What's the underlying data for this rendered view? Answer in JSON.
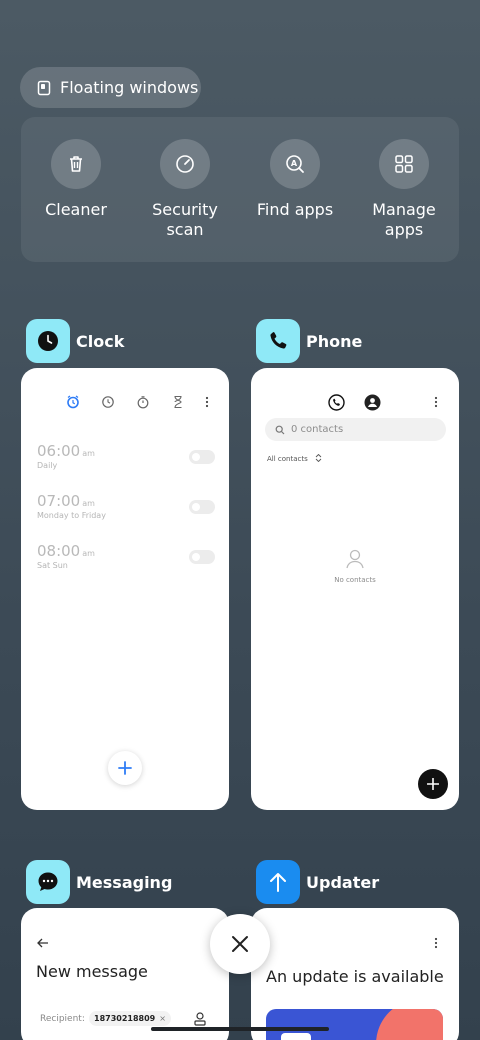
{
  "floating": {
    "label": "Floating windows"
  },
  "tools": [
    {
      "label": "Cleaner",
      "icon": "trash-icon"
    },
    {
      "label": "Security\nscan",
      "icon": "security-scan-icon"
    },
    {
      "label": "Find apps",
      "icon": "find-apps-icon"
    },
    {
      "label": "Manage\napps",
      "icon": "manage-apps-icon"
    }
  ],
  "clock": {
    "title": "Clock",
    "alarms": [
      {
        "time": "06:00",
        "ampm": "am",
        "repeat": "Daily"
      },
      {
        "time": "07:00",
        "ampm": "am",
        "repeat": "Monday to Friday"
      },
      {
        "time": "08:00",
        "ampm": "am",
        "repeat": "Sat Sun"
      }
    ]
  },
  "phone": {
    "title": "Phone",
    "search_placeholder": "0 contacts",
    "filter": "All contacts",
    "empty": "No contacts"
  },
  "messaging": {
    "title": "Messaging",
    "heading": "New message",
    "recipient_label": "Recipient:",
    "recipient_chip": "18730218809"
  },
  "updater": {
    "title": "Updater",
    "heading": "An update is available"
  },
  "colors": {
    "accent": "#2e7cf6",
    "clock_icon_bg": "#8fe9f7",
    "updater_icon_bg": "#1a8cf0"
  }
}
